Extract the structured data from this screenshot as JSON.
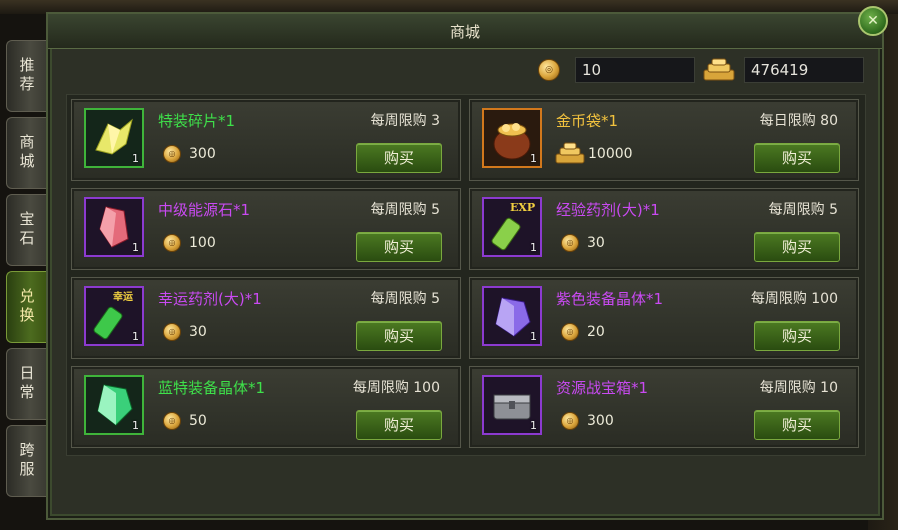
{
  "window": {
    "title": "商城"
  },
  "side_tabs": [
    {
      "label": "推荐",
      "active": false
    },
    {
      "label": "商城",
      "active": false
    },
    {
      "label": "宝石",
      "active": false
    },
    {
      "label": "兑换",
      "active": true
    },
    {
      "label": "日常",
      "active": false
    },
    {
      "label": "跨服",
      "active": false
    }
  ],
  "currency": {
    "coin_amount": "10",
    "gold_amount": "476419"
  },
  "items": [
    {
      "name": "特装碎片*1",
      "limit": "每周限购 3",
      "price": "300",
      "count": "1",
      "rarity": "green",
      "icon": "crystal-shard-icon",
      "buy_label": "购买"
    },
    {
      "name": "金币袋*1",
      "limit": "每日限购 80",
      "price": "10000",
      "count": "1",
      "rarity": "orange",
      "icon": "coin-bag-icon",
      "buy_label": "购买"
    },
    {
      "name": "中级能源石*1",
      "limit": "每周限购 5",
      "price": "100",
      "count": "1",
      "rarity": "purple",
      "icon": "energy-stone-icon",
      "buy_label": "购买"
    },
    {
      "name": "经验药剂(大)*1",
      "limit": "每周限购 5",
      "price": "30",
      "count": "1",
      "rarity": "purple",
      "icon": "exp-potion-icon",
      "badge": "EXP",
      "buy_label": "购买"
    },
    {
      "name": "幸运药剂(大)*1",
      "limit": "每周限购 5",
      "price": "30",
      "count": "1",
      "rarity": "purple",
      "icon": "luck-potion-icon",
      "badge": "幸运",
      "buy_label": "购买"
    },
    {
      "name": "紫色装备晶体*1",
      "limit": "每周限购 100",
      "price": "20",
      "count": "1",
      "rarity": "purple",
      "icon": "purple-crystal-icon",
      "buy_label": "购买"
    },
    {
      "name": "蓝特装备晶体*1",
      "limit": "每周限购 100",
      "price": "50",
      "count": "1",
      "rarity": "green",
      "icon": "green-crystal-icon",
      "buy_label": "购买"
    },
    {
      "name": "资源战宝箱*1",
      "limit": "每周限购 10",
      "price": "300",
      "count": "1",
      "rarity": "purple",
      "icon": "treasure-chest-icon",
      "buy_label": "购买"
    }
  ],
  "colors": {
    "rarity_green": "#3fb43a",
    "rarity_purple": "#8c3ad0",
    "rarity_orange": "#d2781c",
    "button_green": "#4c7a22"
  }
}
